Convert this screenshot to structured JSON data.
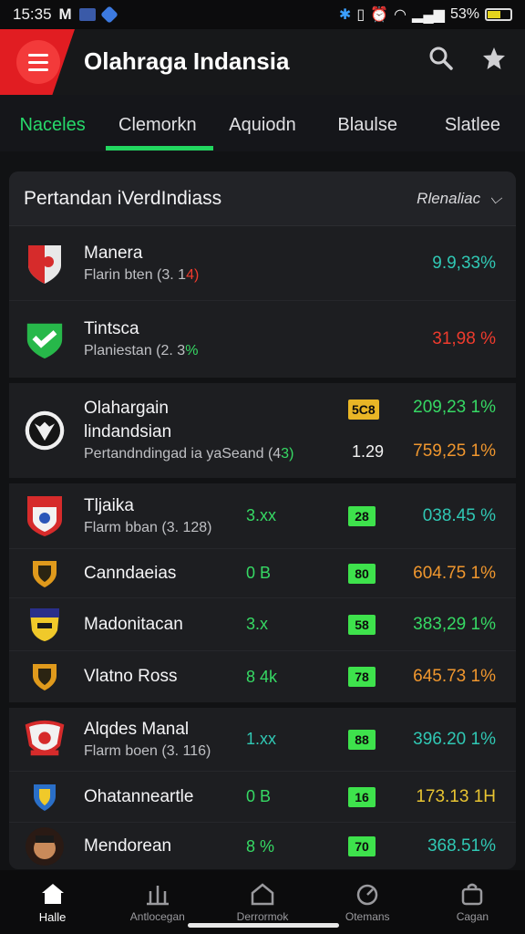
{
  "status_bar": {
    "time": "15:35",
    "m": "M",
    "battery": "53%"
  },
  "header": {
    "title": "Olahraga Indansia"
  },
  "tabs": [
    {
      "label": "Naceles",
      "active": true
    },
    {
      "label": "Clemorkn",
      "active": false
    },
    {
      "label": "Aquiodn",
      "active": false
    },
    {
      "label": "Blaulse",
      "active": false
    },
    {
      "label": "Slatlee",
      "active": false
    }
  ],
  "card": {
    "title": "Pertandan iVerdIndiass",
    "more_label": "Rlenaliac",
    "groups": [
      {
        "rows": [
          {
            "name": "Manera",
            "sub": "Flarin bten (3. 1",
            "sub_accent": "4)",
            "sub_accent_color": "#ef3b2d",
            "a": "",
            "b": "",
            "c": "9.9,33%",
            "c_color": "#30c8b4",
            "logo": "shield-red"
          },
          {
            "name": "Tintsca",
            "sub": "Planiestan (2. 3",
            "sub_accent": "%",
            "sub_accent_color": "#36d964",
            "a": "",
            "b": "",
            "c": "31,98 %",
            "c_color": "#ef3b2d",
            "logo": "shield-green"
          }
        ]
      },
      {
        "rows": [
          {
            "name": "Olahargain lindandsian",
            "sub": "Pertandndingad ia yaSeand (4",
            "sub_accent": "3)",
            "sub_accent_color": "#36d964",
            "a": "",
            "b": "5C8",
            "b_color": "#e9b626",
            "b2": "1.29",
            "c": "209,23 1%",
            "c_color": "#36d964",
            "c2": "759,25 1%",
            "c2_color": "#f0972e",
            "logo": "wolf"
          }
        ]
      },
      {
        "rows": [
          {
            "name": "Tljaika",
            "sub": "Flarm bban (3. 128)",
            "a": "3.xx",
            "a_color": "#36d964",
            "b": "28",
            "b_color": "#3ee24c",
            "c": "038.45 %",
            "c_color": "#30c8b4",
            "logo": "shield-white"
          },
          {
            "name": "Canndaeias",
            "sub": "",
            "a": "0 B",
            "a_color": "#36d964",
            "b": "80",
            "b_color": "#3ee24c",
            "c": "604.75 1%",
            "c_color": "#f0972e",
            "logo": "shield-orange"
          },
          {
            "name": "Madonitacan",
            "sub": "",
            "a": "3.x",
            "a_color": "#36d964",
            "b": "58",
            "b_color": "#3ee24c",
            "c": "383,29 1%",
            "c_color": "#36d964",
            "logo": "face-yellow"
          },
          {
            "name": "Vlatno Ross",
            "sub": "",
            "a": "8 4k",
            "a_color": "#36d964",
            "b": "78",
            "b_color": "#3ee24c",
            "c": "645.73 1%",
            "c_color": "#f0972e",
            "logo": "shield-orange"
          }
        ]
      },
      {
        "rows": [
          {
            "name": "Alqdes Manal",
            "sub": "Flarm boen (3. 116)",
            "a": "1.xx",
            "a_color": "#30c8b4",
            "b": "88",
            "b_color": "#3ee24c",
            "c": "396.20 1%",
            "c_color": "#30c8b4",
            "logo": "crest-red"
          },
          {
            "name": "Ohatanneartle",
            "sub": "",
            "a": "0 B",
            "a_color": "#36d964",
            "b": "16",
            "b_color": "#3ee24c",
            "c": "173.13 1H",
            "c_color": "#e9c532",
            "logo": "shield-blue"
          },
          {
            "name": "Mendorean",
            "sub": "",
            "a": "8 %",
            "a_color": "#36d964",
            "b": "70",
            "b_color": "#3ee24c",
            "c": "368.51%",
            "c_color": "#30c8b4",
            "logo": "face-dark"
          }
        ]
      }
    ]
  },
  "bottom_nav": [
    {
      "label": "Halle",
      "icon": "home-icon",
      "active": true
    },
    {
      "label": "Antlocegan",
      "icon": "trophy-icon",
      "active": false
    },
    {
      "label": "Derrormok",
      "icon": "home-outline-icon",
      "active": false
    },
    {
      "label": "Otemans",
      "icon": "clock-icon",
      "active": false
    },
    {
      "label": "Cagan",
      "icon": "bag-icon",
      "active": false
    }
  ]
}
